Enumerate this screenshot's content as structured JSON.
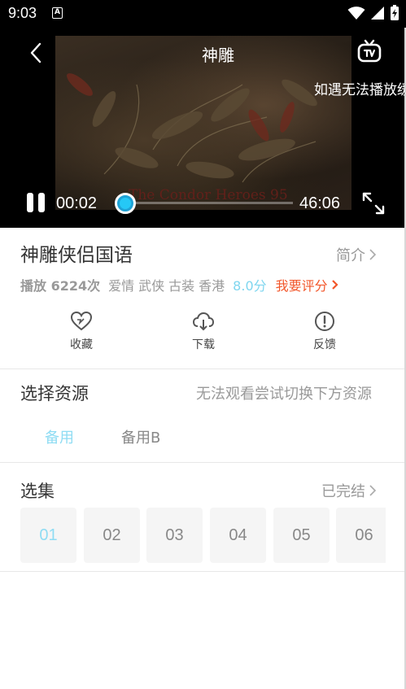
{
  "status_bar": {
    "time": "9:03",
    "notification_glyph": "A"
  },
  "player": {
    "title": "神雕",
    "hint": "如遇无法播放缓",
    "watermark": "The Condor Heroes 95",
    "current_time": "00:02",
    "duration": "46:06",
    "progress_fraction": 0.0
  },
  "info": {
    "title": "神雕侠侣国语",
    "intro_label": "简介",
    "plays": "播放 6224次",
    "tags": [
      "爱情",
      "武侠",
      "古装",
      "香港"
    ],
    "score": "8.0分",
    "rate_label": "我要评分",
    "actions": [
      {
        "label": "收藏",
        "icon": "heart-icon"
      },
      {
        "label": "下载",
        "icon": "cloud-download-icon"
      },
      {
        "label": "反馈",
        "icon": "alert-circle-icon"
      }
    ]
  },
  "sources": {
    "title": "选择资源",
    "hint": "无法观看尝试切换下方资源",
    "tabs": [
      "备用",
      "备用B"
    ],
    "active_index": 0
  },
  "episodes": {
    "title": "选集",
    "status": "已完结",
    "items": [
      "01",
      "02",
      "03",
      "04",
      "05",
      "06"
    ],
    "active_index": 0
  },
  "colors": {
    "accent": "#25c8f6",
    "rate": "#f2562a",
    "score": "#7fd6ef"
  }
}
